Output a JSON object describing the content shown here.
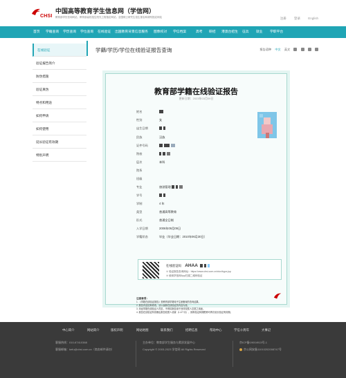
{
  "header": {
    "site_title": "中国高等教育学生信息网（学信网）",
    "site_subtitle": "教育部学历查询网站，教育部高校招生阳光工程指定网站，全国硕士研究生招生报名和调剂指定网站",
    "logo_text": "CHSI",
    "links": [
      "注册",
      "登录",
      "English"
    ]
  },
  "nav": {
    "items": [
      "首页",
      "学籍查询",
      "学历查询",
      "学位查询",
      "在线验证",
      "出国教育背景信息服务",
      "图像校对",
      "学信档案",
      "高考",
      "研招",
      "港澳台招生",
      "征兵",
      "就业",
      "学职平台"
    ]
  },
  "sidebar": {
    "items": [
      "在线验证",
      "验证报告简介",
      "防伪措施",
      "验证真伪",
      "特点和用途",
      "如何申请",
      "如何使用",
      "延长验证有效期",
      "特别声明"
    ],
    "active_index": 0
  },
  "page": {
    "title": "学籍/学历/学位在线验证报告查询",
    "tools": {
      "label": "报告语种",
      "lang_cn": "中文",
      "lang_en": "英文"
    }
  },
  "report": {
    "title": "教育部学籍在线验证报告",
    "update_date": "更新日期：2023年03月09日",
    "fields": [
      {
        "label": "姓名",
        "value": ""
      },
      {
        "label": "性别",
        "value": "女"
      },
      {
        "label": "出生日期",
        "value": ""
      },
      {
        "label": "民族",
        "value": "汉族"
      },
      {
        "label": "证件号码",
        "value": ""
      },
      {
        "label": "院校",
        "value": ""
      },
      {
        "label": "层次",
        "value": "本科"
      },
      {
        "label": "院系",
        "value": ""
      },
      {
        "label": "班级",
        "value": ""
      },
      {
        "label": "专业",
        "value": "旅游管理"
      },
      {
        "label": "学号",
        "value": ""
      },
      {
        "label": "学制",
        "value": "4 年"
      },
      {
        "label": "类型",
        "value": "普通高等教育"
      },
      {
        "label": "形式",
        "value": "普通全日制"
      },
      {
        "label": "入学日期",
        "value": "2006年09月09日"
      },
      {
        "label": "学籍状态",
        "value": "毕业（毕业日期：2010年06月30日）"
      }
    ],
    "verify": {
      "label": "在线验证码",
      "code": "AHAA",
      "line1": "① 验证报告查询网址：https://www.chsi.com.cn/xlcx/bgcx.jsp",
      "line2": "② 使用学信网App扫描二维码验证"
    },
    "notes_title": "注意事项：",
    "notes": [
      "1. 《学籍在线验证报告》是教育部学籍电子注册备案的查询结果。",
      "2. 报告内容如有修改，请以最新在线验证的内容为准。",
      "3. 未经学籍在线验证人同意，不得将报告用于违背权属人意愿之用途。",
      "4. 报告在线验证有效期由报告权属人设置（1-6个月），拥有验证码期限即可再次延长验证有效期。"
    ]
  },
  "footer": {
    "links": [
      "中心简介",
      "网站简介",
      "版权声明",
      "网站地图",
      "联系我们",
      "招聘信息",
      "帮助中心",
      "学信十周年",
      "大事记"
    ],
    "phone": "客服热线：010-67410388",
    "email": "客服邮箱：kefu@chsi.com.cn（商务邮件请勿）",
    "host": "主办单位：教育部学生服务与素质发展中心",
    "copyright": "Copyright © 2003-2023 学信网 All Rights Reserved",
    "icp": "京ICP备19004913号-1",
    "police": "京公网安备11010202008747号"
  }
}
